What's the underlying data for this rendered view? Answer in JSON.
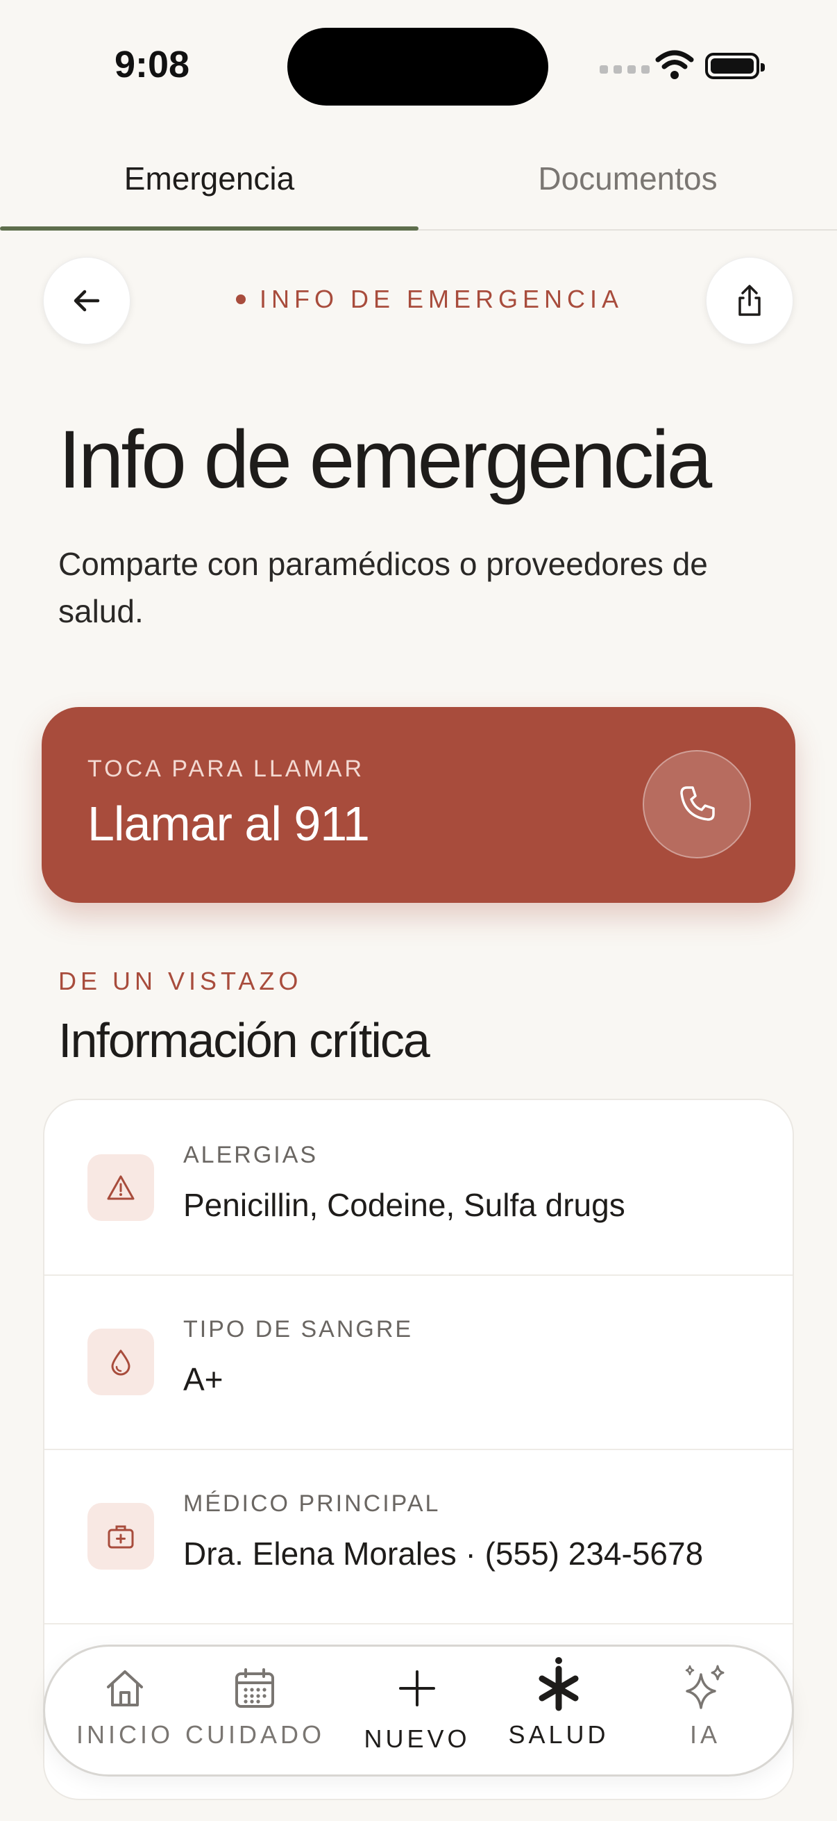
{
  "status_bar": {
    "time": "9:08"
  },
  "tabs": [
    {
      "label": "Emergencia",
      "active": true
    },
    {
      "label": "Documentos",
      "active": false
    }
  ],
  "header": {
    "eyebrow": "INFO DE EMERGENCIA"
  },
  "page": {
    "title": "Info de emergencia",
    "subtitle": "Comparte con paramédicos o proveedores de salud."
  },
  "call_card": {
    "label": "TOCA PARA LLAMAR",
    "title": "Llamar al 911",
    "icon": "phone-icon"
  },
  "section": {
    "eyebrow": "DE UN VISTAZO",
    "title": "Información crítica"
  },
  "critical_info": [
    {
      "label": "ALERGIAS",
      "value": "Penicillin, Codeine, Sulfa drugs",
      "icon": "warning-icon"
    },
    {
      "label": "TIPO DE SANGRE",
      "value": "A+",
      "icon": "blood-drop-icon"
    },
    {
      "label": "MÉDICO PRINCIPAL",
      "value": "Dra. Elena Morales · (555) 234-5678",
      "icon": "medical-kit-icon"
    }
  ],
  "bottom_nav": [
    {
      "label": "INICIO",
      "icon": "home-icon"
    },
    {
      "label": "CUIDADO",
      "icon": "calendar-icon"
    },
    {
      "label": "NUEVO",
      "icon": "plus-icon"
    },
    {
      "label": "SALUD",
      "icon": "asterisk-icon",
      "active": true
    },
    {
      "label": "IA",
      "icon": "sparkles-icon"
    }
  ],
  "colors": {
    "accent": "#a84c3c",
    "tab_underline": "#5e6e4c",
    "background": "#f9f7f3"
  }
}
